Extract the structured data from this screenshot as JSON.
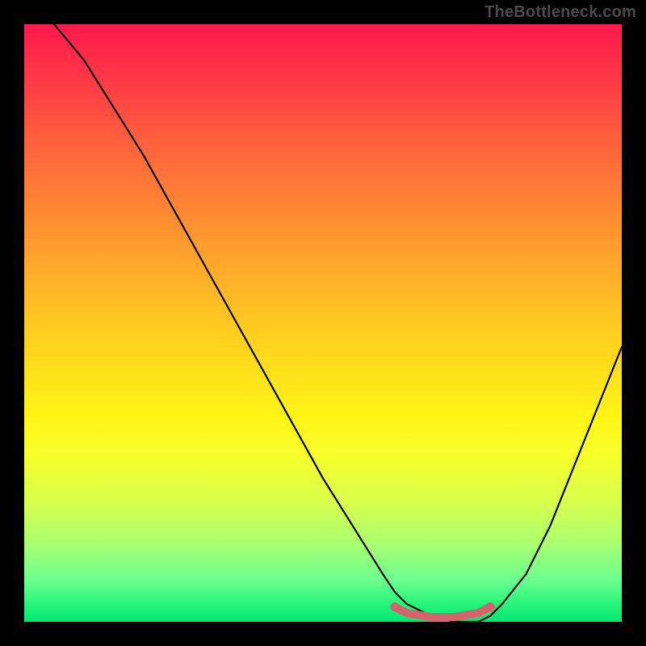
{
  "watermark": "TheBottleneck.com",
  "chart_data": {
    "type": "line",
    "title": "",
    "xlabel": "",
    "ylabel": "",
    "xlim": [
      0,
      100
    ],
    "ylim": [
      0,
      100
    ],
    "series": [
      {
        "name": "curve",
        "color": "#000000",
        "x": [
          5,
          10,
          15,
          20,
          25,
          30,
          35,
          40,
          45,
          50,
          55,
          60,
          62,
          64,
          68,
          72,
          76,
          78,
          80,
          84,
          88,
          92,
          96,
          100
        ],
        "y": [
          100,
          94,
          86,
          78,
          69,
          60,
          51,
          42,
          33,
          24,
          16,
          8,
          5,
          3,
          1,
          0,
          0,
          1,
          3,
          8,
          16,
          26,
          36,
          46
        ]
      },
      {
        "name": "trough-marker",
        "color": "#d4636b",
        "x": [
          62,
          64,
          68,
          72,
          76,
          78
        ],
        "y": [
          2.5,
          1.5,
          0.8,
          0.8,
          1.5,
          2.5
        ]
      }
    ],
    "gradient_stops": [
      {
        "pos": 0,
        "color": "#ff1a4d"
      },
      {
        "pos": 50,
        "color": "#ffd020"
      },
      {
        "pos": 75,
        "color": "#f5ff30"
      },
      {
        "pos": 100,
        "color": "#00e874"
      }
    ]
  }
}
